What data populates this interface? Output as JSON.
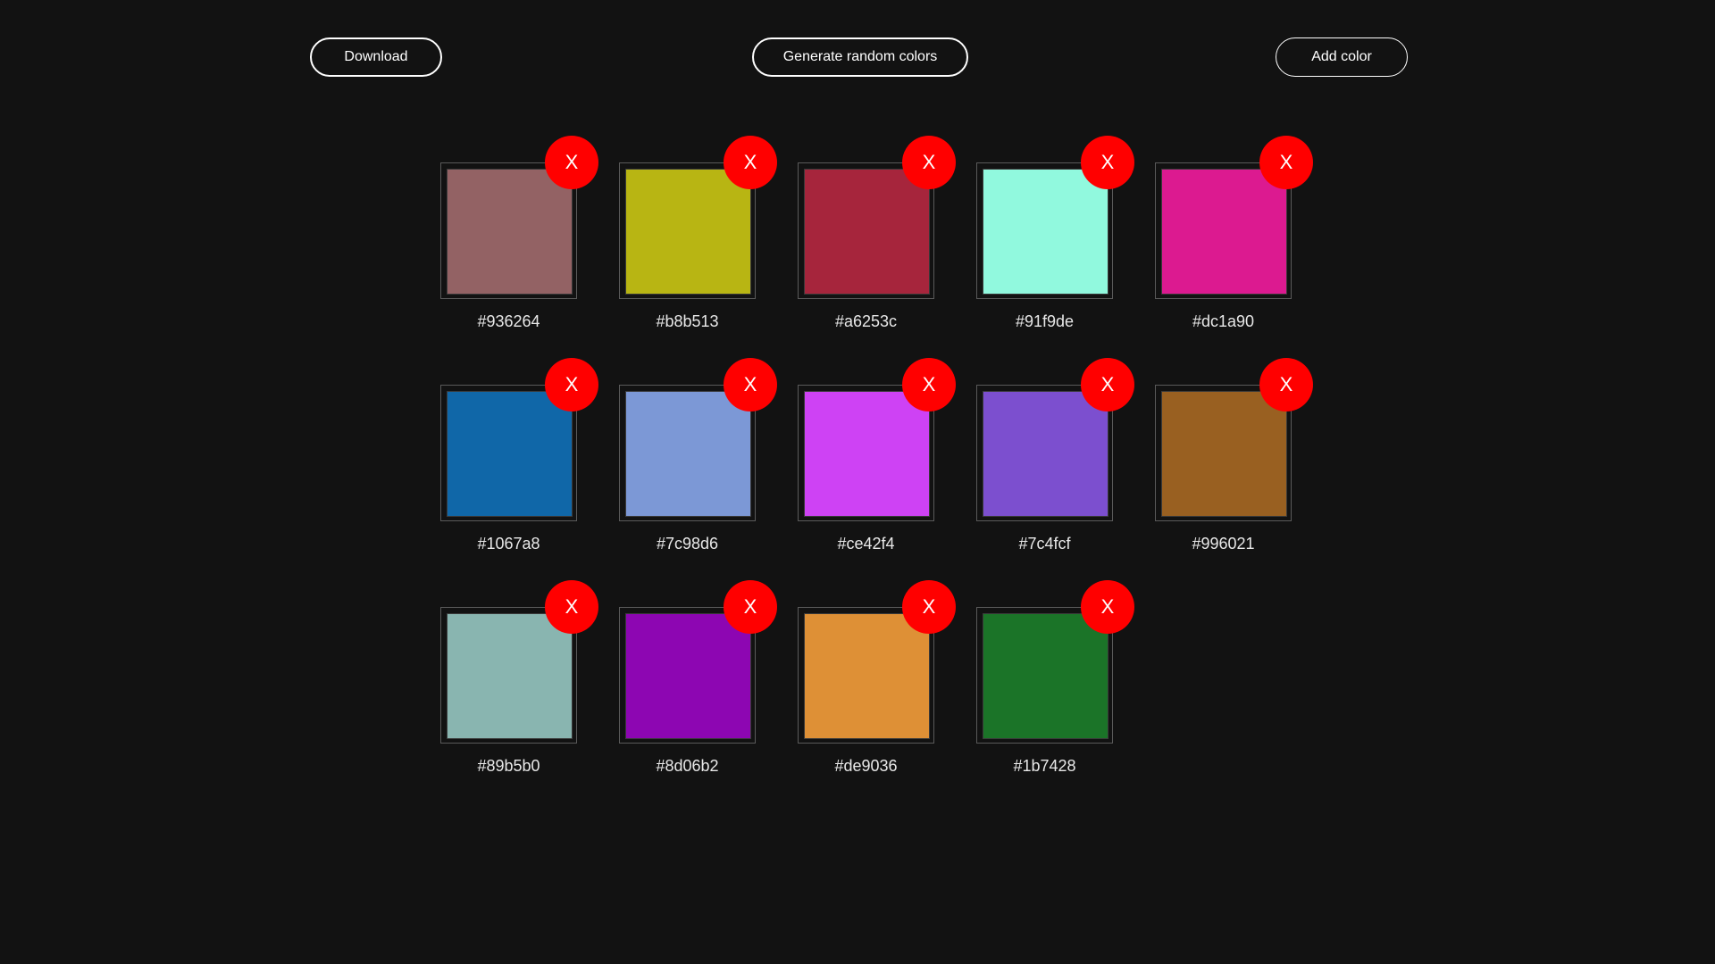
{
  "toolbar": {
    "download_label": "Download",
    "random_label": "Generate random colors",
    "add_label": "Add color"
  },
  "palette": {
    "remove_label": "X",
    "colors": [
      {
        "hex": "#936264"
      },
      {
        "hex": "#b8b513"
      },
      {
        "hex": "#a6253c"
      },
      {
        "hex": "#91f9de"
      },
      {
        "hex": "#dc1a90"
      },
      {
        "hex": "#1067a8"
      },
      {
        "hex": "#7c98d6"
      },
      {
        "hex": "#ce42f4"
      },
      {
        "hex": "#7c4fcf"
      },
      {
        "hex": "#996021"
      },
      {
        "hex": "#89b5b0"
      },
      {
        "hex": "#8d06b2"
      },
      {
        "hex": "#de9036"
      },
      {
        "hex": "#1b7428"
      }
    ]
  },
  "theme": {
    "background": "#121212",
    "remove_button": "#ff0000"
  }
}
